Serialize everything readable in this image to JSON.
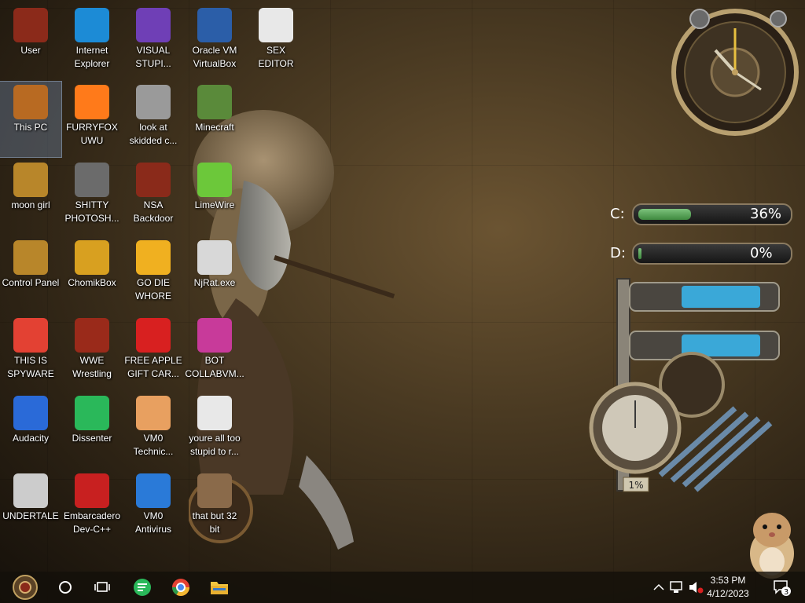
{
  "desktop": {
    "icons": [
      {
        "label": "User",
        "icon": "user-folder-icon",
        "color": "#8b2a1a"
      },
      {
        "label": "Internet\nExplorer",
        "icon": "edge-icon",
        "color": "#1c8bd6"
      },
      {
        "label": "VISUAL\nSTUPI...",
        "icon": "visual-studio-icon",
        "color": "#6f3fb6"
      },
      {
        "label": "Oracle VM\nVirtualBox",
        "icon": "virtualbox-icon",
        "color": "#2b5ea8"
      },
      {
        "label": "SEX\nEDITOR",
        "icon": "hxd-icon",
        "color": "#e8e8e8"
      },
      {
        "label": "This PC",
        "icon": "this-pc-icon",
        "color": "#b86a22"
      },
      {
        "label": "FURRYFOX\nUWU",
        "icon": "firefox-icon",
        "color": "#ff7a1a"
      },
      {
        "label": "look at\nskidded c...",
        "icon": "copy-files-icon",
        "color": "#9a9a9a"
      },
      {
        "label": "Minecraft",
        "icon": "minecraft-icon",
        "color": "#5a8a3a"
      },
      {
        "label": "moon girl",
        "icon": "book-icon",
        "color": "#b8862a"
      },
      {
        "label": "SHITTY\nPHOTOSH...",
        "icon": "gimp-icon",
        "color": "#6b6b6b"
      },
      {
        "label": "NSA\nBackdoor",
        "icon": "picture-icon",
        "color": "#8a2a1a"
      },
      {
        "label": "LimeWire",
        "icon": "limewire-icon",
        "color": "#6cc83a"
      },
      {
        "label": "Control Panel",
        "icon": "control-panel-icon",
        "color": "#b8862a"
      },
      {
        "label": "ChomikBox",
        "icon": "chomikbox-icon",
        "color": "#d8a020"
      },
      {
        "label": "GO DIE\nWHORE",
        "icon": "de-icon",
        "color": "#f0b020"
      },
      {
        "label": "NjRat.exe",
        "icon": "skull-icon",
        "color": "#d8d8d8"
      },
      {
        "label": "THIS IS\nSPYWARE",
        "icon": "chrome-icon",
        "color": "#e34133"
      },
      {
        "label": "WWE\nWrestling",
        "icon": "tv-icon",
        "color": "#9a2a1a"
      },
      {
        "label": "FREE APPLE\nGIFT CAR...",
        "icon": "apple-icon",
        "color": "#d82020"
      },
      {
        "label": "BOT\nCOLLABVM...",
        "icon": "monitor-icon",
        "color": "#c83a9a"
      },
      {
        "label": "Audacity",
        "icon": "audacity-icon",
        "color": "#2a6ad8"
      },
      {
        "label": "Dissenter",
        "icon": "dissenter-icon",
        "color": "#2ab85a"
      },
      {
        "label": "VM0\nTechnic...",
        "icon": "technician-icon",
        "color": "#e8a060"
      },
      {
        "label": "youre all too\nstupid to r...",
        "icon": "sketch-face-icon",
        "color": "#e8e8e8"
      },
      {
        "label": "UNDERTALE",
        "icon": "unity-icon",
        "color": "#cccccc"
      },
      {
        "label": "Embarcadero\nDev-C++",
        "icon": "devcpp-icon",
        "color": "#c82020"
      },
      {
        "label": "VM0\nAntivirus",
        "icon": "shield-icon",
        "color": "#2a7ad8"
      },
      {
        "label": "that but 32\nbit",
        "icon": "portrait-icon",
        "color": "#8a6a4a"
      }
    ]
  },
  "widgets": {
    "drive_c": {
      "label": "C:",
      "percent": 36,
      "percent_text": "36%"
    },
    "drive_d": {
      "label": "D:",
      "percent": 0,
      "percent_text": "0%"
    },
    "cpu_gauge_text": "1%"
  },
  "taskbar": {
    "items": [
      "start-button",
      "cortana-circle-icon",
      "task-view-icon",
      "dissenter-taskbar-icon",
      "chrome-taskbar-icon",
      "file-explorer-icon"
    ],
    "clock_time": "3:53 PM",
    "clock_date": "4/12/2023",
    "notification_count": "3"
  }
}
